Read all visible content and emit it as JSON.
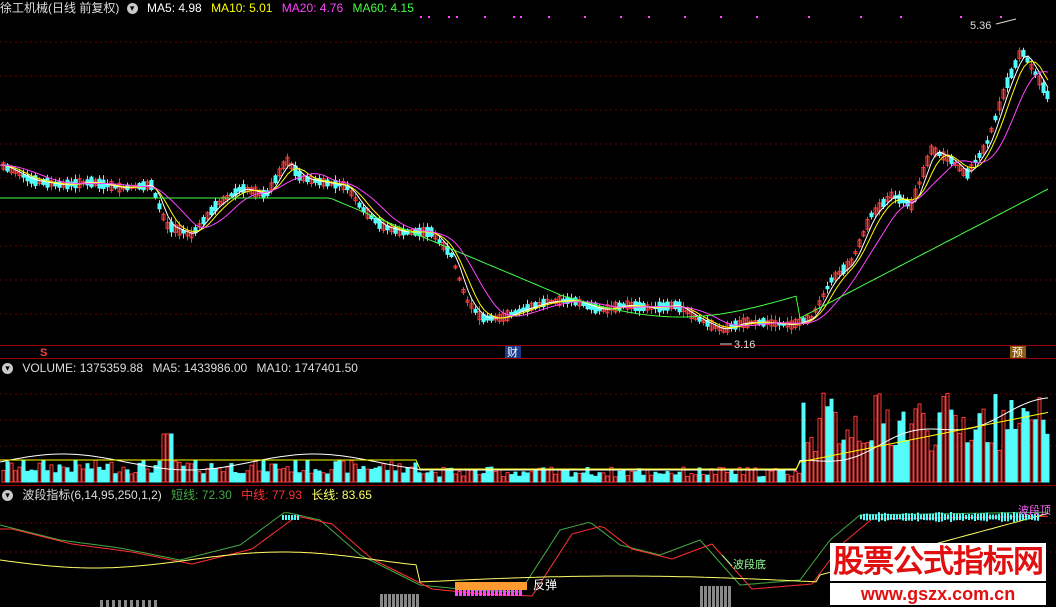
{
  "price_panel": {
    "title": "徐工机械(日线 前复权)",
    "ma_labels": [
      {
        "text": "MA5: 4.98",
        "color": "#ffffff"
      },
      {
        "text": "MA10: 5.01",
        "color": "#ffff00"
      },
      {
        "text": "MA20: 4.76",
        "color": "#ff44ff"
      },
      {
        "text": "MA60: 4.15",
        "color": "#44ff44"
      }
    ],
    "high_label": "5.36",
    "low_label": "3.16",
    "markers": {
      "left": "S",
      "cai": "财",
      "yu": "预"
    }
  },
  "volume_panel": {
    "label": "VOLUME: 1375359.88",
    "ma5": "MA5: 1433986.00",
    "ma10": "MA10: 1747401.50"
  },
  "indicator_panel": {
    "name": "波段指标(6,14,95,250,1,2)",
    "short_label": "短线",
    "short_value": "72.30",
    "mid_label": "中线",
    "mid_value": "77.93",
    "long_label": "长线",
    "long_value": "83.65",
    "annotations": {
      "rebound": "反弹",
      "wave_bottom": "波段底",
      "wave_top": "波段顶"
    }
  },
  "watermark": {
    "line1": "股票公式指标网",
    "line2": "www.gszx.com.cn"
  },
  "colors": {
    "up": "#ff3a3a",
    "down": "#54fcfc",
    "grid": "#7a0000",
    "short": "#44aa44",
    "mid": "#ff3030",
    "long": "#ffff66"
  }
}
